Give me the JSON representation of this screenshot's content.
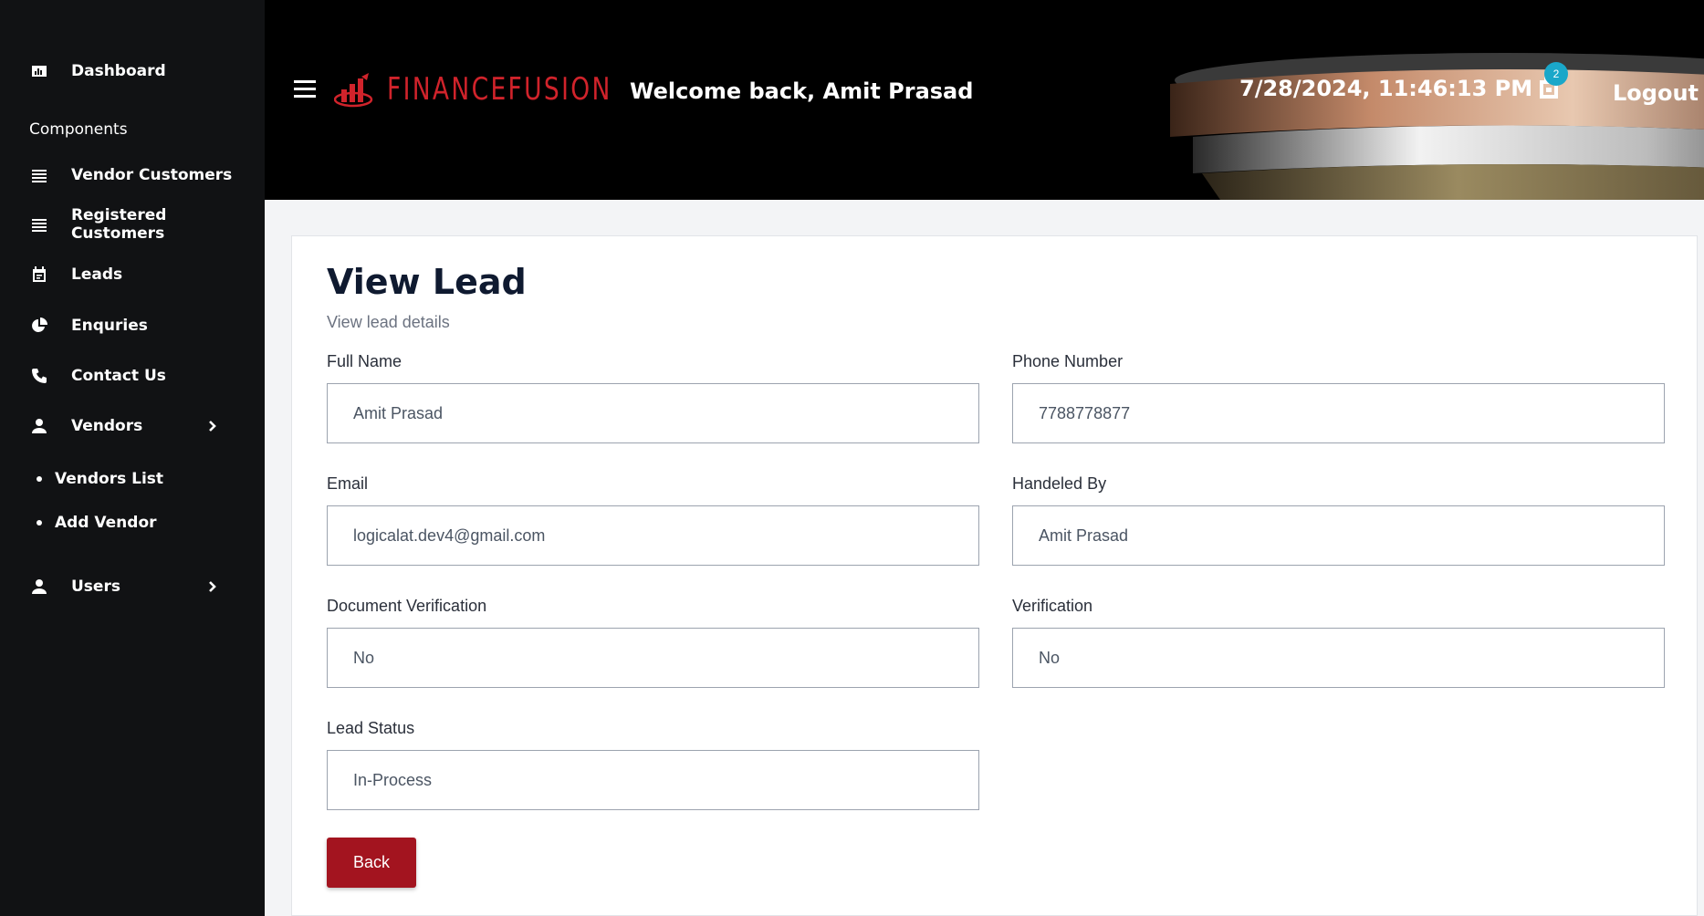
{
  "sidebar": {
    "dashboard": "Dashboard",
    "section_label": "Components",
    "items": [
      {
        "label": "Vendor Customers",
        "icon": "list-icon"
      },
      {
        "label": "Registered Customers",
        "icon": "list-icon"
      },
      {
        "label": "Leads",
        "icon": "calendar-icon"
      },
      {
        "label": "Enquries",
        "icon": "pie-chart-icon"
      },
      {
        "label": "Contact Us",
        "icon": "phone-icon"
      },
      {
        "label": "Vendors",
        "icon": "user-icon"
      },
      {
        "label": "Users",
        "icon": "user-icon"
      }
    ],
    "vendor_sub_items": [
      "Vendors List",
      "Add Vendor"
    ]
  },
  "header": {
    "brand": "FINANCEFUSION",
    "welcome": "Welcome back, Amit Prasad",
    "datetime": "7/28/2024, 11:46:13 PM",
    "cart_count": "2",
    "logout": "Logout"
  },
  "main": {
    "title": "View Lead",
    "subtitle": "View lead details",
    "fields": {
      "full_name": {
        "label": "Full Name",
        "value": "Amit Prasad"
      },
      "phone": {
        "label": "Phone Number",
        "value": "7788778877"
      },
      "email": {
        "label": "Email",
        "value": "logicalat.dev4@gmail.com"
      },
      "handled_by": {
        "label": "Handeled By",
        "value": "Amit Prasad"
      },
      "doc_verification": {
        "label": "Document Verification",
        "value": "No"
      },
      "verification": {
        "label": "Verification",
        "value": "No"
      },
      "lead_status": {
        "label": "Lead Status",
        "value": "In-Process"
      }
    },
    "back_label": "Back"
  },
  "colors": {
    "sidebar_bg": "#111214",
    "brand_red": "#d0232b",
    "button_red": "#a3141f",
    "badge": "#1aa7c9"
  }
}
